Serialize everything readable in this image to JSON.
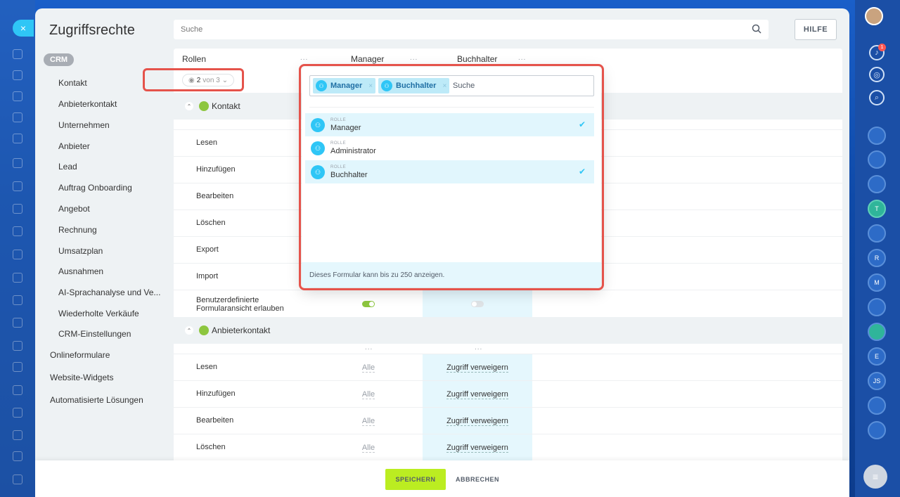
{
  "panel": {
    "title": "Zugriffsrechte",
    "search_placeholder": "Suche",
    "help_label": "HILFE",
    "close_icon": "×"
  },
  "nav": {
    "section_badge": "CRM",
    "sub_items": [
      "Kontakt",
      "Anbieterkontakt",
      "Unternehmen",
      "Anbieter",
      "Lead",
      "Auftrag Onboarding",
      "Angebot",
      "Rechnung",
      "Umsatzplan",
      "Ausnahmen",
      "AI-Sprachanalyse und Ve...",
      "Wiederholte Verkäufe",
      "CRM-Einstellungen"
    ],
    "top_items": [
      "Onlineformulare",
      "Website-Widgets",
      "Automatisierte Lösungen"
    ]
  },
  "table": {
    "roles_header": "Rollen",
    "columns": [
      "Manager",
      "Buchhalter"
    ],
    "filter": {
      "count": "2",
      "of_label": "von 3"
    },
    "sections": [
      {
        "title": "Kontakt",
        "rows": [
          "Lesen",
          "Hinzufügen",
          "Bearbeiten",
          "Löschen",
          "Export",
          "Import",
          "Benutzerdefinierte Formularansicht erlauben"
        ]
      },
      {
        "title": "Anbieterkontakt",
        "rows": [
          {
            "label": "Lesen",
            "manager": "Alle",
            "buchhalter": "Zugriff verweigern"
          },
          {
            "label": "Hinzufügen",
            "manager": "Alle",
            "buchhalter": "Zugriff verweigern"
          },
          {
            "label": "Bearbeiten",
            "manager": "Alle",
            "buchhalter": "Zugriff verweigern"
          },
          {
            "label": "Löschen",
            "manager": "Alle",
            "buchhalter": "Zugriff verweigern"
          }
        ]
      }
    ],
    "col_more": "..."
  },
  "popup": {
    "tags": [
      "Manager",
      "Buchhalter"
    ],
    "search_label": "Suche",
    "items": [
      {
        "type": "ROLLE",
        "name": "Manager",
        "selected": true
      },
      {
        "type": "ROLLE",
        "name": "Administrator",
        "selected": false
      },
      {
        "type": "ROLLE",
        "name": "Buchhalter",
        "selected": true
      }
    ],
    "footer": "Dieses Formular kann bis zu 250 anzeigen."
  },
  "footer": {
    "save": "SPEICHERN",
    "cancel": "ABBRECHEN"
  },
  "rail": {
    "badge_count": "1",
    "avatars": [
      "T",
      "R",
      "M",
      "E",
      "JS"
    ]
  },
  "colors": {
    "accent": "#2fc6f6",
    "save": "#bbed21",
    "frame": "#e5534b",
    "selected_col": "#e5f7fd"
  }
}
